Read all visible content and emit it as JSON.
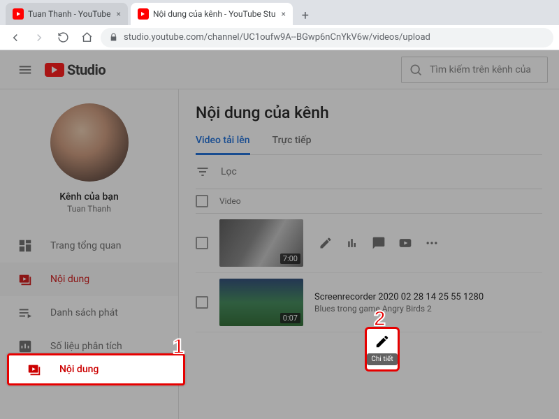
{
  "browser": {
    "tabs": [
      {
        "title": "Tuan Thanh - YouTube"
      },
      {
        "title": "Nội dung của kênh - YouTube Stu"
      }
    ],
    "url": "studio.youtube.com/channel/UC1oufw9A--BGwp6nCnYkV6w/videos/upload"
  },
  "app": {
    "logo_text": "Studio",
    "search_placeholder": "Tìm kiếm trên kênh của"
  },
  "sidebar": {
    "channel_label": "Kênh của bạn",
    "channel_name": "Tuan Thanh",
    "items": [
      {
        "label": "Trang tổng quan"
      },
      {
        "label": "Nội dung"
      },
      {
        "label": "Danh sách phát"
      },
      {
        "label": "Số liệu phân tích"
      }
    ]
  },
  "main": {
    "title": "Nội dung của kênh",
    "tabs": [
      {
        "label": "Video tải lên"
      },
      {
        "label": "Trực tiếp"
      }
    ],
    "filter_label": "Lọc",
    "column_video": "Video",
    "videos": [
      {
        "duration": "7:00",
        "title": "",
        "subtitle": ""
      },
      {
        "duration": "0:07",
        "title": "Screenrecorder 2020 02 28 14 25 55 1280",
        "subtitle": "Blues trong game Angry Birds 2"
      }
    ]
  },
  "annotations": {
    "num1": "1",
    "num2": "2",
    "tooltip_detail": "Chi tiết",
    "callout1_label": "Nội dung"
  }
}
